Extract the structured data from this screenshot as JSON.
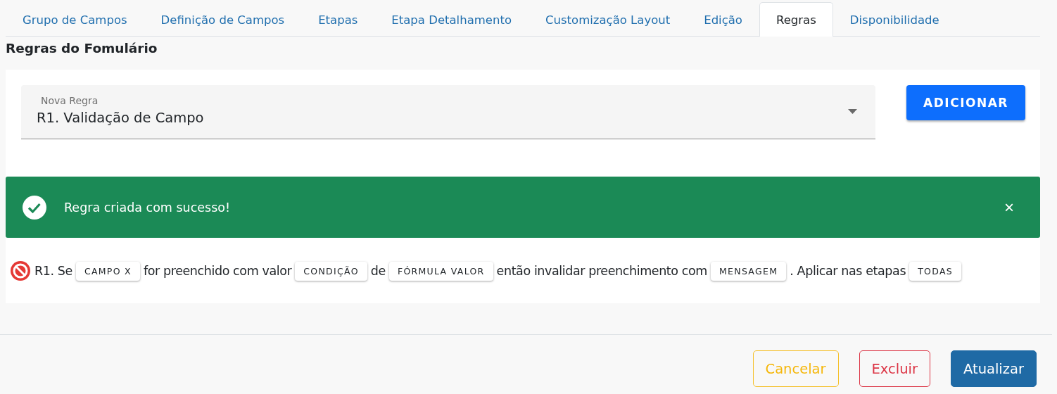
{
  "tabs": [
    {
      "label": "Grupo de Campos",
      "selected": false
    },
    {
      "label": "Definição de Campos",
      "selected": false
    },
    {
      "label": "Etapas",
      "selected": false
    },
    {
      "label": "Etapa Detalhamento",
      "selected": false
    },
    {
      "label": "Customização Layout",
      "selected": false
    },
    {
      "label": "Edição",
      "selected": false
    },
    {
      "label": "Regras",
      "selected": true
    },
    {
      "label": "Disponibilidade",
      "selected": false
    }
  ],
  "heading": "Regras do Fomulário",
  "new_rule": {
    "label": "Nova Regra",
    "value": "R1. Validação de Campo",
    "button": "ADICIONAR"
  },
  "alert": {
    "message": "Regra criada com sucesso!",
    "close": "×"
  },
  "rule": [
    {
      "kind": "text",
      "text": "R1. Se"
    },
    {
      "kind": "chip",
      "text": "CAMPO X"
    },
    {
      "kind": "text",
      "text": "for preenchido com valor"
    },
    {
      "kind": "chip",
      "text": "CONDIÇÃO"
    },
    {
      "kind": "text",
      "text": "de"
    },
    {
      "kind": "chip",
      "text": "FÓRMULA VALOR"
    },
    {
      "kind": "text",
      "text": "então invalidar preenchimento com"
    },
    {
      "kind": "chip",
      "text": "MENSAGEM"
    },
    {
      "kind": "text",
      "text": ". Aplicar nas etapas"
    },
    {
      "kind": "chip",
      "text": "TODAS"
    }
  ],
  "actions": [
    {
      "kind": "cancel",
      "label": "Cancelar"
    },
    {
      "kind": "delete",
      "label": "Excluir"
    },
    {
      "kind": "update",
      "label": "Atualizar"
    }
  ]
}
